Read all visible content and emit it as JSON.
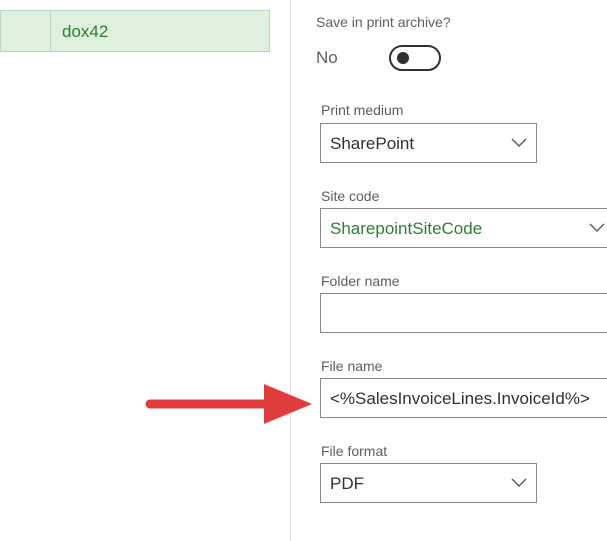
{
  "list": {
    "rows": [
      {
        "value": "dox42"
      }
    ]
  },
  "form": {
    "archive": {
      "label": "Save in print archive?",
      "value": "No"
    },
    "print_medium": {
      "label": "Print medium",
      "value": "SharePoint"
    },
    "site_code": {
      "label": "Site code",
      "value": "SharepointSiteCode"
    },
    "folder_name": {
      "label": "Folder name",
      "value": ""
    },
    "file_name": {
      "label": "File name",
      "value": "<%SalesInvoiceLines.InvoiceId%>"
    },
    "file_format": {
      "label": "File format",
      "value": "PDF"
    }
  },
  "colors": {
    "selected_row_bg": "#dff0df",
    "link_green": "#2e7d32",
    "annotation_arrow": "#e03c3c"
  },
  "icons": [
    "chevron-down-icon",
    "annotation-arrow"
  ]
}
